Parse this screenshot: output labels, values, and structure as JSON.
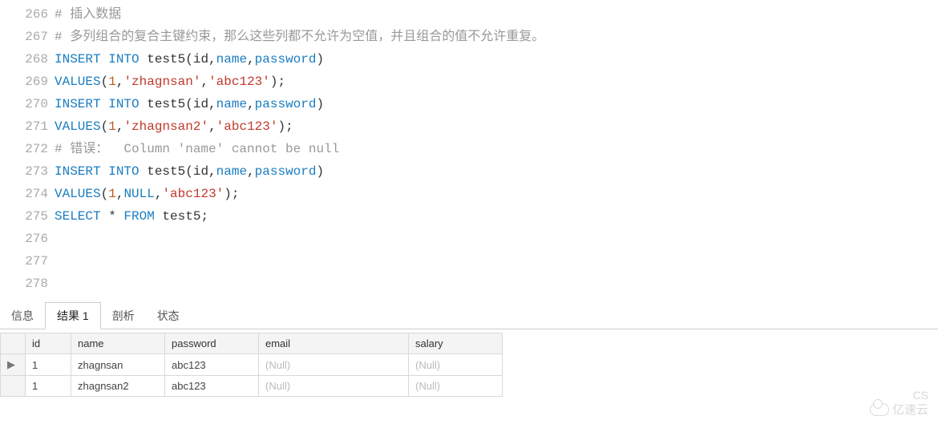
{
  "lines": [
    {
      "n": "266",
      "tokens": [
        {
          "t": "# 插入数据",
          "c": "cmt"
        }
      ]
    },
    {
      "n": "267",
      "tokens": [
        {
          "t": "# 多列组合的复合主键约束，那么这些列都不允许为空值，并且组合的值不允许重复。",
          "c": "cmt"
        }
      ]
    },
    {
      "n": "268",
      "tokens": [
        {
          "t": "INSERT",
          "c": "kw"
        },
        {
          "t": " ",
          "c": "op"
        },
        {
          "t": "INTO",
          "c": "kw"
        },
        {
          "t": " test5(id,",
          "c": "op"
        },
        {
          "t": "name",
          "c": "ident"
        },
        {
          "t": ",",
          "c": "op"
        },
        {
          "t": "password",
          "c": "ident"
        },
        {
          "t": ")",
          "c": "op"
        }
      ]
    },
    {
      "n": "269",
      "tokens": [
        {
          "t": "VALUES",
          "c": "kw"
        },
        {
          "t": "(",
          "c": "op"
        },
        {
          "t": "1",
          "c": "num"
        },
        {
          "t": ",",
          "c": "op"
        },
        {
          "t": "'zhagnsan'",
          "c": "str"
        },
        {
          "t": ",",
          "c": "op"
        },
        {
          "t": "'abc123'",
          "c": "str"
        },
        {
          "t": ");",
          "c": "op"
        }
      ]
    },
    {
      "n": "270",
      "tokens": [
        {
          "t": "",
          "c": "op"
        }
      ]
    },
    {
      "n": "271",
      "tokens": [
        {
          "t": "INSERT",
          "c": "kw"
        },
        {
          "t": " ",
          "c": "op"
        },
        {
          "t": "INTO",
          "c": "kw"
        },
        {
          "t": " test5(id,",
          "c": "op"
        },
        {
          "t": "name",
          "c": "ident"
        },
        {
          "t": ",",
          "c": "op"
        },
        {
          "t": "password",
          "c": "ident"
        },
        {
          "t": ")",
          "c": "op"
        }
      ]
    },
    {
      "n": "272",
      "tokens": [
        {
          "t": "VALUES",
          "c": "kw"
        },
        {
          "t": "(",
          "c": "op"
        },
        {
          "t": "1",
          "c": "num"
        },
        {
          "t": ",",
          "c": "op"
        },
        {
          "t": "'zhagnsan2'",
          "c": "str"
        },
        {
          "t": ",",
          "c": "op"
        },
        {
          "t": "'abc123'",
          "c": "str"
        },
        {
          "t": ");",
          "c": "op"
        }
      ]
    },
    {
      "n": "273",
      "tokens": [
        {
          "t": "",
          "c": "op"
        }
      ]
    },
    {
      "n": "274",
      "tokens": [
        {
          "t": "# 错误：  Column 'name' cannot be null",
          "c": "cmt"
        }
      ]
    },
    {
      "n": "275",
      "tokens": [
        {
          "t": "INSERT",
          "c": "kw"
        },
        {
          "t": " ",
          "c": "op"
        },
        {
          "t": "INTO",
          "c": "kw"
        },
        {
          "t": " test5(id,",
          "c": "op"
        },
        {
          "t": "name",
          "c": "ident"
        },
        {
          "t": ",",
          "c": "op"
        },
        {
          "t": "password",
          "c": "ident"
        },
        {
          "t": ")",
          "c": "op"
        }
      ]
    },
    {
      "n": "276",
      "tokens": [
        {
          "t": "VALUES",
          "c": "kw"
        },
        {
          "t": "(",
          "c": "op"
        },
        {
          "t": "1",
          "c": "num"
        },
        {
          "t": ",",
          "c": "op"
        },
        {
          "t": "NULL",
          "c": "kw"
        },
        {
          "t": ",",
          "c": "op"
        },
        {
          "t": "'abc123'",
          "c": "str"
        },
        {
          "t": ");",
          "c": "op"
        }
      ]
    },
    {
      "n": "277",
      "tokens": [
        {
          "t": "",
          "c": "op"
        }
      ]
    },
    {
      "n": "278",
      "tokens": [
        {
          "t": "SELECT",
          "c": "kw"
        },
        {
          "t": " * ",
          "c": "op"
        },
        {
          "t": "FROM",
          "c": "kw"
        },
        {
          "t": " test5;",
          "c": "op"
        }
      ]
    }
  ],
  "tabs": {
    "info": "信息",
    "result": "结果 1",
    "profile": "剖析",
    "status": "状态"
  },
  "grid": {
    "headers": {
      "id": "id",
      "name": "name",
      "password": "password",
      "email": "email",
      "salary": "salary"
    },
    "rows": [
      {
        "marker": "▶",
        "id": "1",
        "name": "zhagnsan",
        "password": "abc123",
        "email": "(Null)",
        "salary": "(Null)"
      },
      {
        "marker": "",
        "id": "1",
        "name": "zhagnsan2",
        "password": "abc123",
        "email": "(Null)",
        "salary": "(Null)"
      }
    ]
  },
  "watermark": {
    "cs": "CS",
    "brand": "亿速云"
  }
}
